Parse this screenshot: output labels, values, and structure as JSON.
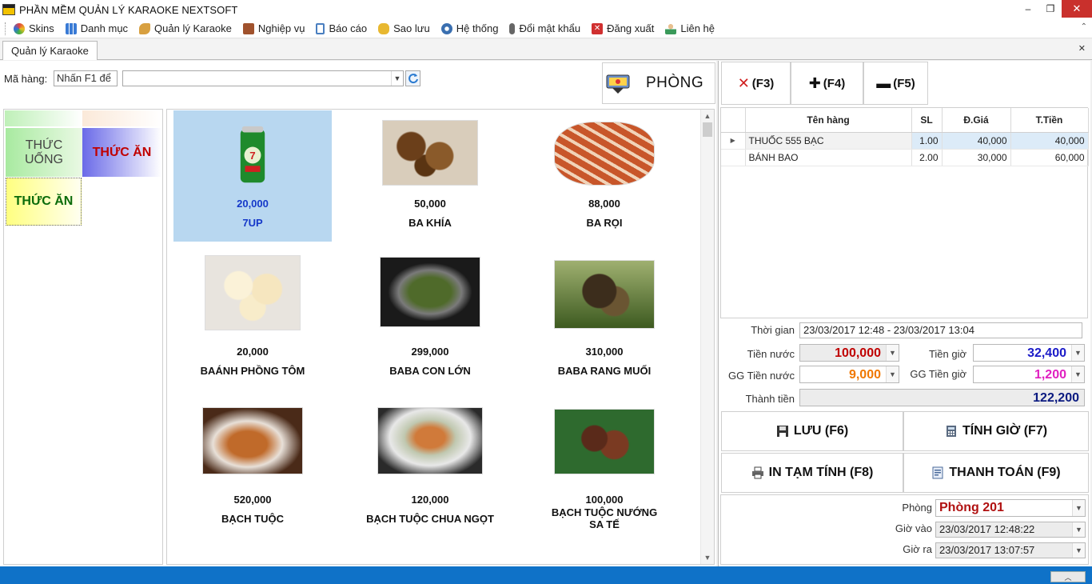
{
  "window": {
    "title": "PHẦN MỀM QUẢN LÝ KARAOKE NEXTSOFT",
    "minimize_glyph": "–",
    "restore_glyph": "❐",
    "close_glyph": "✕"
  },
  "menu": [
    {
      "label": "Skins",
      "icon": "palette-icon",
      "color": "#e04040"
    },
    {
      "label": "Danh mục",
      "icon": "grid-icon",
      "color": "#3a7bd5"
    },
    {
      "label": "Quản lý Karaoke",
      "icon": "pencil-icon",
      "color": "#d8a040"
    },
    {
      "label": "Nghiệp vụ",
      "icon": "briefcase-icon",
      "color": "#a0522d"
    },
    {
      "label": "Báo cáo",
      "icon": "clipboard-icon",
      "color": "#4a7fc0"
    },
    {
      "label": "Sao lưu",
      "icon": "database-icon",
      "color": "#e8b830"
    },
    {
      "label": "Hệ thống",
      "icon": "gears-icon",
      "color": "#3a6fb0"
    },
    {
      "label": "Đổi mật khẩu",
      "icon": "microphone-icon",
      "color": "#555555"
    },
    {
      "label": "Đăng xuất",
      "icon": "logout-icon",
      "color": "#d03030"
    },
    {
      "label": "Liên hệ",
      "icon": "user-icon",
      "color": "#3a9a5a"
    }
  ],
  "tabs": {
    "active": "Quản lý Karaoke"
  },
  "search": {
    "label": "Mã hàng:",
    "code_value": "Nhấn F1 để",
    "combo_value": ""
  },
  "phong_button": {
    "label": "PHÒNG"
  },
  "categories": {
    "uong": "THỨC UỐNG",
    "an_1": "THỨC ĂN",
    "an_2": "THỨC ĂN"
  },
  "products": [
    {
      "price": "20,000",
      "name": "7UP",
      "image": "soda-can",
      "selected": true
    },
    {
      "price": "50,000",
      "name": "BA KHÍA",
      "image": "fried-crab"
    },
    {
      "price": "88,000",
      "name": "BA RỌI",
      "image": "pork-belly"
    },
    {
      "price": "20,000",
      "name": "BAÁNH PHỒNG TÔM",
      "image": "prawn-crackers"
    },
    {
      "price": "299,000",
      "name": "BABA CON LỚN",
      "image": "turtle-hotpot"
    },
    {
      "price": "310,000",
      "name": "BABA RANG MUỐI",
      "image": "salt-roasted-turtle"
    },
    {
      "price": "520,000",
      "name": "BẠCH TUỘC",
      "image": "grilled-octopus"
    },
    {
      "price": "120,000",
      "name": "BẠCH TUỘC CHUA NGỌT",
      "image": "sweet-sour-octopus"
    },
    {
      "price": "100,000",
      "name": "BẠCH TUỘC NƯỚNG SA TẾ",
      "image": "satay-octopus"
    }
  ],
  "fkeys": {
    "delete": "(F3)",
    "add": "(F4)",
    "subtract": "(F5)"
  },
  "order": {
    "columns": [
      "Tên hàng",
      "SL",
      "Đ.Giá",
      "T.Tiền"
    ],
    "rows": [
      {
        "name": "THUỐC 555 BẠC",
        "qty": "1.00",
        "price": "40,000",
        "total": "40,000"
      },
      {
        "name": "BÁNH BAO",
        "qty": "2.00",
        "price": "30,000",
        "total": "60,000"
      }
    ]
  },
  "summary": {
    "time_label": "Thời gian",
    "time_value": "23/03/2017 12:48 - 23/03/2017 13:04",
    "drink_label": "Tiền nước",
    "drink_value": "100,000",
    "hour_label": "Tiền giờ",
    "hour_value": "32,400",
    "drink_disc_label": "GG Tiền nước",
    "drink_disc_value": "9,000",
    "hour_disc_label": "GG Tiền giờ",
    "hour_disc_value": "1,200",
    "total_label": "Thành tiền",
    "total_value": "122,200"
  },
  "actions": {
    "save": "LƯU (F6)",
    "calc": "TÍNH GIỜ (F7)",
    "print": "IN TẠM TÍNH (F8)",
    "pay": "THANH TOÁN (F9)"
  },
  "room": {
    "room_label": "Phòng",
    "room_value": "Phòng 201",
    "in_label": "Giờ vào",
    "in_value": "23/03/2017 12:48:22",
    "out_label": "Giờ ra",
    "out_value": "23/03/2017 13:07:57"
  },
  "colors": {
    "drink": "#c00000",
    "hour": "#1a1ac8",
    "drink_disc": "#f07800",
    "hour_disc": "#e020c0",
    "total": "#0a1a80",
    "room": "#b01010"
  }
}
